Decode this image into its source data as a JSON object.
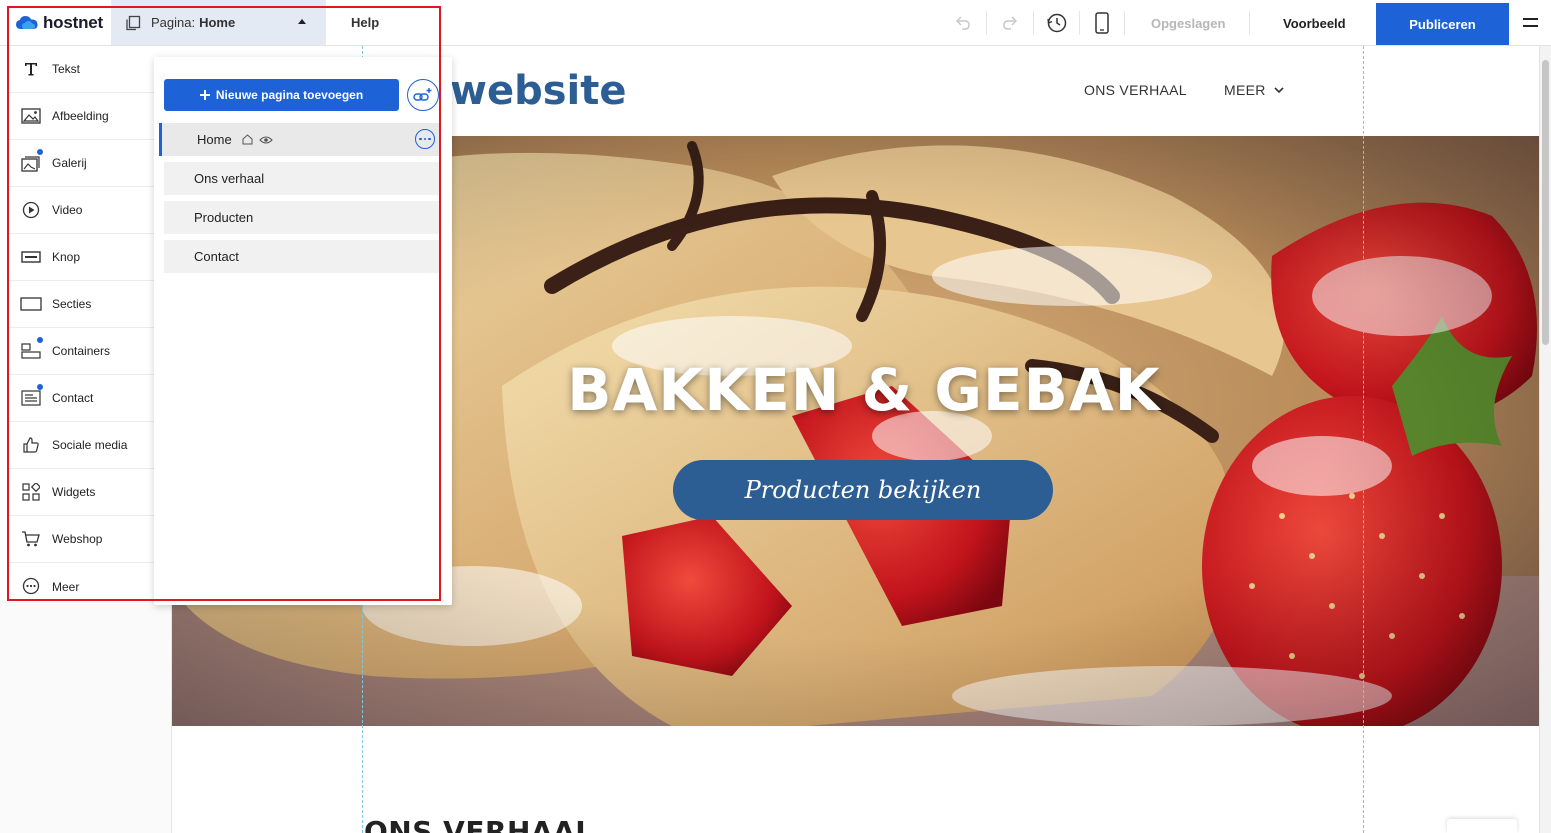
{
  "app": {
    "logo": "hostnet"
  },
  "toolbar": {
    "page_label": "Pagina:",
    "page_value": "Home",
    "help": "Help",
    "saved": "Opgeslagen",
    "preview": "Voorbeeld",
    "publish": "Publiceren"
  },
  "widgets": {
    "items": [
      {
        "label": "Tekst",
        "icon": "text-icon"
      },
      {
        "label": "Afbeelding",
        "icon": "image-icon"
      },
      {
        "label": "Galerij",
        "icon": "gallery-icon"
      },
      {
        "label": "Video",
        "icon": "video-icon"
      },
      {
        "label": "Knop",
        "icon": "button-icon"
      },
      {
        "label": "Secties",
        "icon": "sections-icon"
      },
      {
        "label": "Containers",
        "icon": "containers-icon"
      },
      {
        "label": "Contact",
        "icon": "contact-icon"
      },
      {
        "label": "Sociale media",
        "icon": "thumbs-up-icon"
      },
      {
        "label": "Widgets",
        "icon": "widgets-icon"
      },
      {
        "label": "Webshop",
        "icon": "cart-icon"
      },
      {
        "label": "Meer",
        "icon": "more-icon"
      }
    ]
  },
  "pages": {
    "new_page": "Nieuwe pagina toevoegen",
    "items": [
      "Home",
      "Ons verhaal",
      "Producten",
      "Contact"
    ]
  },
  "site": {
    "logo": "website",
    "nav": [
      "ONS VERHAAL",
      "MEER"
    ],
    "hero_title": "BAKKEN & GEBAK",
    "hero_button": "Producten bekijken",
    "section_title": "ONS VERHAAL"
  },
  "colors": {
    "accent": "#1d62d6",
    "site_primary": "#2c5e94",
    "highlight_box": "#e3161f"
  }
}
